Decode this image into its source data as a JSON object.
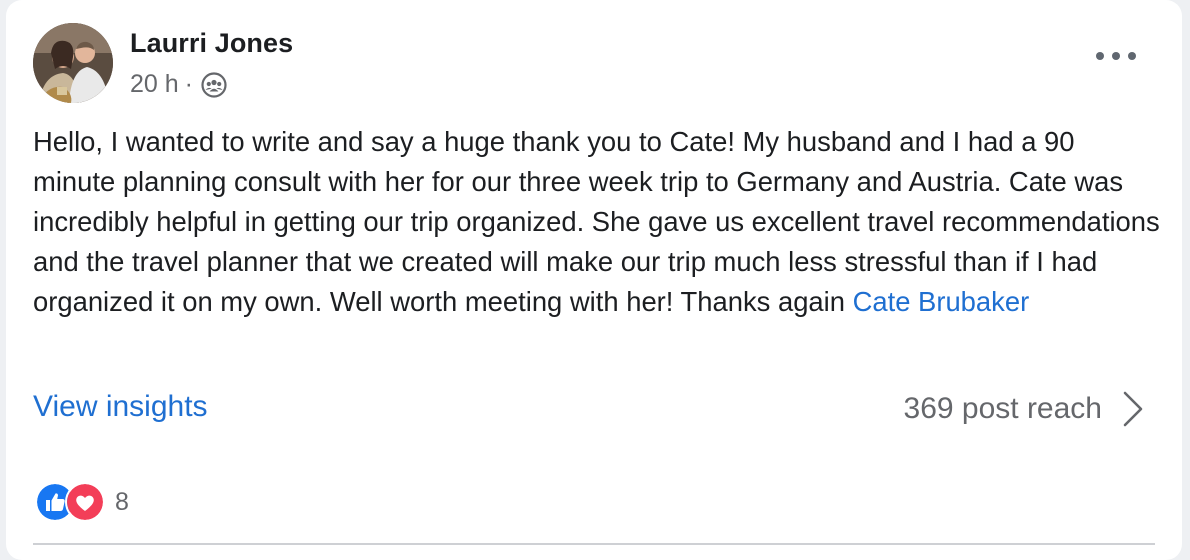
{
  "post": {
    "author": "Laurri Jones",
    "time": "20 h",
    "separator": "·",
    "audience_icon": "group-icon",
    "body": "Hello, I wanted to write and say a huge thank you to Cate! My husband and I had a 90 minute planning consult with her for our three week trip to Germany and Austria. Cate was incredibly helpful in getting our trip organized. She gave us excellent travel recommendations and the travel planner that we created will make our trip much less stressful than if I had organized it on my own. Well worth meeting with her! Thanks again ",
    "mention": "Cate Brubaker"
  },
  "insights": {
    "link_label": "View insights",
    "reach_label": "369 post reach"
  },
  "reactions": {
    "icons": [
      "like-icon",
      "love-icon"
    ],
    "count": "8"
  },
  "colors": {
    "link": "#1f6fd1",
    "like": "#1877f2",
    "love": "#f33e58",
    "secondary_text": "#65676b"
  }
}
